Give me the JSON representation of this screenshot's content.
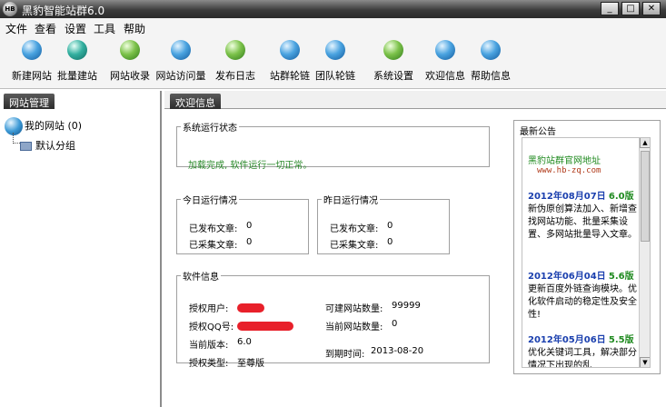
{
  "window": {
    "title": "黑豹智能站群6.0",
    "minimize": "_",
    "maximize": "□",
    "close": "✕"
  },
  "menu": [
    "文件",
    "查看",
    "设置",
    "工具",
    "帮助"
  ],
  "toolbar": [
    {
      "label": "新建网站",
      "icon": "new-site-icon"
    },
    {
      "label": "批量建站",
      "icon": "batch-site-icon"
    },
    {
      "label": "网站收录",
      "icon": "site-index-icon"
    },
    {
      "label": "网站访问量",
      "icon": "site-visits-icon"
    },
    {
      "label": "发布日志",
      "icon": "publish-log-icon"
    },
    {
      "label": "站群轮链",
      "icon": "site-chain-icon"
    },
    {
      "label": "团队轮链",
      "icon": "team-chain-icon"
    },
    {
      "label": "系统设置",
      "icon": "settings-icon"
    },
    {
      "label": "欢迎信息",
      "icon": "welcome-icon"
    },
    {
      "label": "帮助信息",
      "icon": "help-icon"
    }
  ],
  "left_panel": {
    "tab": "网站管理",
    "root": "我的网站 (0)",
    "child": "默认分组"
  },
  "right_panel": {
    "tab": "欢迎信息"
  },
  "system_status": {
    "title": "系统运行状态",
    "message": "加载完成, 软件运行一切正常。"
  },
  "today": {
    "title": "今日运行情况",
    "published_label": "已发布文章:",
    "published": "0",
    "collected_label": "已采集文章:",
    "collected": "0"
  },
  "yesterday": {
    "title": "昨日运行情况",
    "published_label": "已发布文章:",
    "published": "0",
    "collected_label": "已采集文章:",
    "collected": "0"
  },
  "software": {
    "title": "软件信息",
    "user_label": "授权用户:",
    "qq_label": "授权QQ号:",
    "version_label": "当前版本:",
    "version": "6.0",
    "type_label": "授权类型:",
    "type": "至尊版",
    "max_sites_label": "可建网站数量:",
    "max_sites": "99999",
    "current_sites_label": "当前网站数量:",
    "current_sites": "0",
    "expire_label": "到期时间:",
    "expire": "2013-08-20"
  },
  "notice": {
    "title": "最新公告",
    "site_title": "黑豹站群官网地址",
    "site_url": "www.hb-zq.com",
    "items": [
      {
        "date": "2012年08月07日",
        "version": "6.0版",
        "text": "新伪原创算法加入、新增查找网站功能、批量采集设置、多网站批量导入文章。"
      },
      {
        "date": "2012年06月04日",
        "version": "5.6版",
        "text": "更新百度外链查询模块。优化软件启动的稳定性及安全性!"
      },
      {
        "date": "2012年05月06日",
        "version": "5.5版",
        "text": "优化关键词工具，解决部分情况下出现的乱"
      }
    ]
  },
  "colors": {
    "status_ok": "#2b8a2b",
    "date": "#1a3fae",
    "version": "#1f8a1f",
    "url": "#b03a1a"
  }
}
